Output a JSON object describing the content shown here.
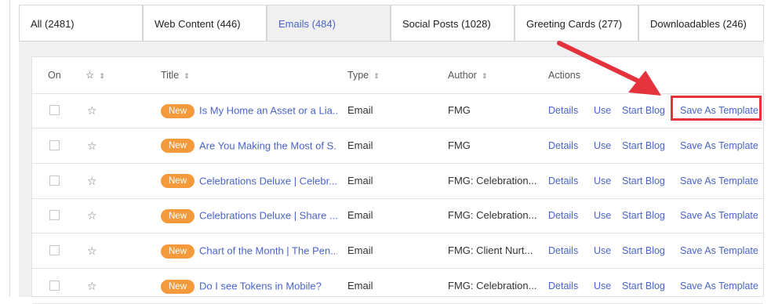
{
  "tabs": [
    {
      "label": "All (2481)",
      "active": false
    },
    {
      "label": "Web Content (446)",
      "active": false
    },
    {
      "label": "Emails (484)",
      "active": true
    },
    {
      "label": "Social Posts (1028)",
      "active": false
    },
    {
      "label": "Greeting Cards (277)",
      "active": false
    },
    {
      "label": "Downloadables (246)",
      "active": false
    }
  ],
  "table": {
    "headers": {
      "on": "On",
      "star": "☆",
      "title": "Title",
      "type": "Type",
      "author": "Author",
      "actions": "Actions"
    },
    "sort_icon": "⇕",
    "rows": [
      {
        "badge": "New",
        "title": "Is My Home an Asset or a Lia...",
        "type": "Email",
        "author": "FMG",
        "actions": [
          "Details",
          "Use",
          "Start Blog",
          "Save As Template"
        ]
      },
      {
        "badge": "New",
        "title": "Are You Making the Most of S...",
        "type": "Email",
        "author": "FMG",
        "actions": [
          "Details",
          "Use",
          "Start Blog",
          "Save As Template"
        ]
      },
      {
        "badge": "New",
        "title": "Celebrations Deluxe | Celebr...",
        "type": "Email",
        "author": "FMG: Celebration...",
        "actions": [
          "Details",
          "Use",
          "Start Blog",
          "Save As Template"
        ]
      },
      {
        "badge": "New",
        "title": "Celebrations Deluxe | Share ...",
        "type": "Email",
        "author": "FMG: Celebration...",
        "actions": [
          "Details",
          "Use",
          "Start Blog",
          "Save As Template"
        ]
      },
      {
        "badge": "New",
        "title": "Chart of the Month | The Pen...",
        "type": "Email",
        "author": "FMG: Client Nurt...",
        "actions": [
          "Details",
          "Use",
          "Start Blog",
          "Save As Template"
        ]
      },
      {
        "badge": "New",
        "title": "Do I see Tokens in Mobile?",
        "type": "Email",
        "author": "FMG: Celebration...",
        "actions": [
          "Details",
          "Use",
          "Start Blog",
          "Save As Template"
        ]
      }
    ]
  },
  "annotation": {
    "color": "#e5333d",
    "highlighted_action": "Save As Template",
    "highlighted_row": 0
  },
  "colors": {
    "accent": "#4a64c9",
    "badge": "#f59a3b",
    "panel": "#f0f0f0"
  }
}
